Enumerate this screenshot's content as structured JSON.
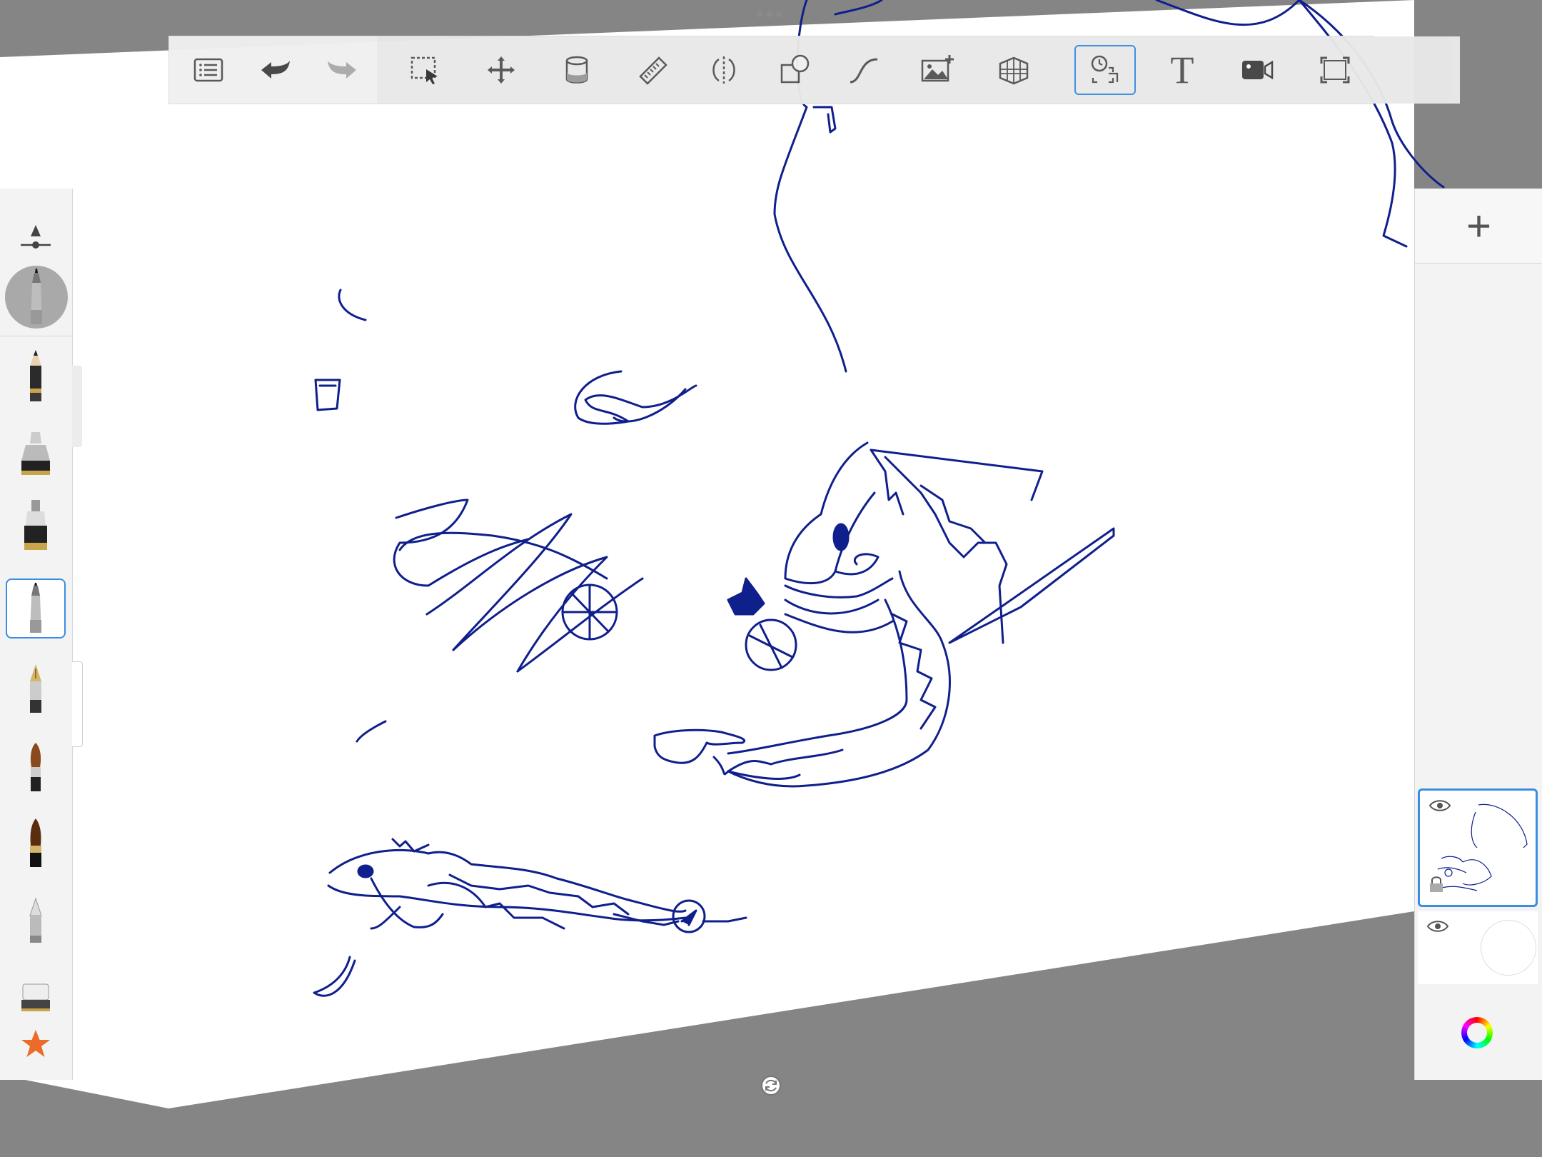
{
  "toolbar": {
    "tools": [
      {
        "name": "layers-menu",
        "icon": "list-icon"
      },
      {
        "name": "undo",
        "icon": "undo-icon"
      },
      {
        "name": "redo",
        "icon": "redo-icon"
      },
      {
        "name": "selection",
        "icon": "selection-icon"
      },
      {
        "name": "transform",
        "icon": "move-icon"
      },
      {
        "name": "fill",
        "icon": "bucket-icon"
      },
      {
        "name": "ruler",
        "icon": "ruler-icon"
      },
      {
        "name": "symmetry",
        "icon": "symmetry-icon"
      },
      {
        "name": "shapes",
        "icon": "shapes-icon"
      },
      {
        "name": "stroke",
        "icon": "curve-icon"
      },
      {
        "name": "import-image",
        "icon": "add-image-icon"
      },
      {
        "name": "perspective",
        "icon": "perspective-icon"
      },
      {
        "name": "time-lapse",
        "icon": "timelapse-icon",
        "active": true
      },
      {
        "name": "text",
        "icon": "text-icon",
        "label": "T"
      },
      {
        "name": "record",
        "icon": "video-icon"
      },
      {
        "name": "fullscreen",
        "icon": "fullscreen-icon"
      }
    ]
  },
  "brushes": [
    "brush-size-slider",
    "pencil",
    "marker",
    "airbrush",
    "ballpoint-pen",
    "fountain-pen",
    "paint-brush",
    "ink-brush",
    "chisel-marker",
    "eraser",
    "favorites-star"
  ],
  "active_brush": "ballpoint-pen",
  "layers": {
    "add_label": "+",
    "items": [
      {
        "name": "layer-1",
        "visible": true,
        "active": true,
        "locked": true
      },
      {
        "name": "background",
        "visible": true,
        "active": false
      }
    ]
  },
  "colors": {
    "ink": "#0f1f8c",
    "accent": "#3b8de0",
    "backdrop": "#858585",
    "panel": "#f3f3f3",
    "star": "#ec6a2a"
  }
}
